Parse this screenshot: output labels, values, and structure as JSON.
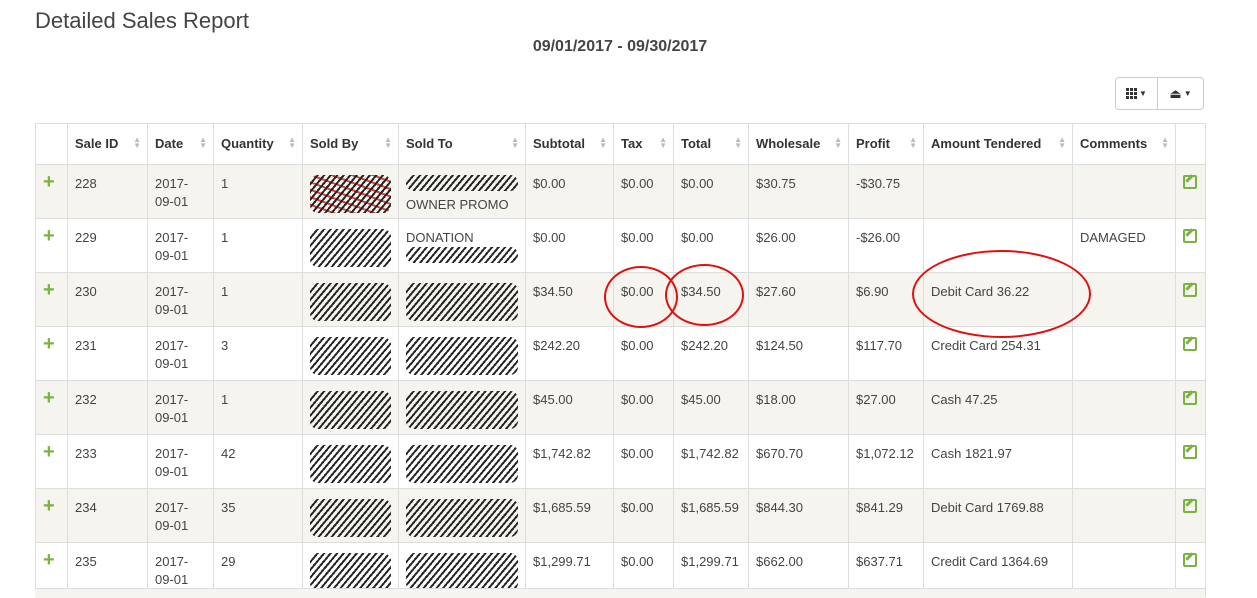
{
  "header": {
    "title": "Detailed Sales Report",
    "date_range": "09/01/2017 - 09/30/2017"
  },
  "toolbar": {
    "columns_icon": "grid-icon",
    "export_icon": "export-icon"
  },
  "table": {
    "columns": [
      "",
      "Sale ID",
      "Date",
      "Quantity",
      "Sold By",
      "Sold To",
      "Subtotal",
      "Tax",
      "Total",
      "Wholesale",
      "Profit",
      "Amount Tendered",
      "Comments",
      ""
    ],
    "rows": [
      {
        "id": "228",
        "date_a": "2017-",
        "date_b": "09-01",
        "qty": "1",
        "sold_to": "OWNER PROMO",
        "subtotal": "$0.00",
        "tax": "$0.00",
        "total": "$0.00",
        "wholesale": "$30.75",
        "profit": "-$30.75",
        "tendered": "",
        "comments": ""
      },
      {
        "id": "229",
        "date_a": "2017-",
        "date_b": "09-01",
        "qty": "1",
        "sold_to": "DONATION",
        "subtotal": "$0.00",
        "tax": "$0.00",
        "total": "$0.00",
        "wholesale": "$26.00",
        "profit": "-$26.00",
        "tendered": "",
        "comments": "DAMAGED"
      },
      {
        "id": "230",
        "date_a": "2017-",
        "date_b": "09-01",
        "qty": "1",
        "sold_to": "",
        "subtotal": "$34.50",
        "tax": "$0.00",
        "total": "$34.50",
        "wholesale": "$27.60",
        "profit": "$6.90",
        "tendered": "Debit Card 36.22",
        "comments": ""
      },
      {
        "id": "231",
        "date_a": "2017-",
        "date_b": "09-01",
        "qty": "3",
        "sold_to": "",
        "subtotal": "$242.20",
        "tax": "$0.00",
        "total": "$242.20",
        "wholesale": "$124.50",
        "profit": "$117.70",
        "tendered": "Credit Card 254.31",
        "comments": ""
      },
      {
        "id": "232",
        "date_a": "2017-",
        "date_b": "09-01",
        "qty": "1",
        "sold_to": "",
        "subtotal": "$45.00",
        "tax": "$0.00",
        "total": "$45.00",
        "wholesale": "$18.00",
        "profit": "$27.00",
        "tendered": "Cash 47.25",
        "comments": ""
      },
      {
        "id": "233",
        "date_a": "2017-",
        "date_b": "09-01",
        "qty": "42",
        "sold_to": "",
        "subtotal": "$1,742.82",
        "tax": "$0.00",
        "total": "$1,742.82",
        "wholesale": "$670.70",
        "profit": "$1,072.12",
        "tendered": "Cash 1821.97",
        "comments": ""
      },
      {
        "id": "234",
        "date_a": "2017-",
        "date_b": "09-01",
        "qty": "35",
        "sold_to": "",
        "subtotal": "$1,685.59",
        "tax": "$0.00",
        "total": "$1,685.59",
        "wholesale": "$844.30",
        "profit": "$841.29",
        "tendered": "Debit Card 1769.88",
        "comments": ""
      },
      {
        "id": "235",
        "date_a": "2017-",
        "date_b": "09-01",
        "qty": "29",
        "sold_to": "",
        "subtotal": "$1,299.71",
        "tax": "$0.00",
        "total": "$1,299.71",
        "wholesale": "$662.00",
        "profit": "$637.71",
        "tendered": "Credit Card 1364.69",
        "comments": ""
      }
    ]
  },
  "colors": {
    "accent_green": "#7bb342",
    "annotation_red": "#e01010",
    "row_stripe": "#f5f4ef"
  }
}
